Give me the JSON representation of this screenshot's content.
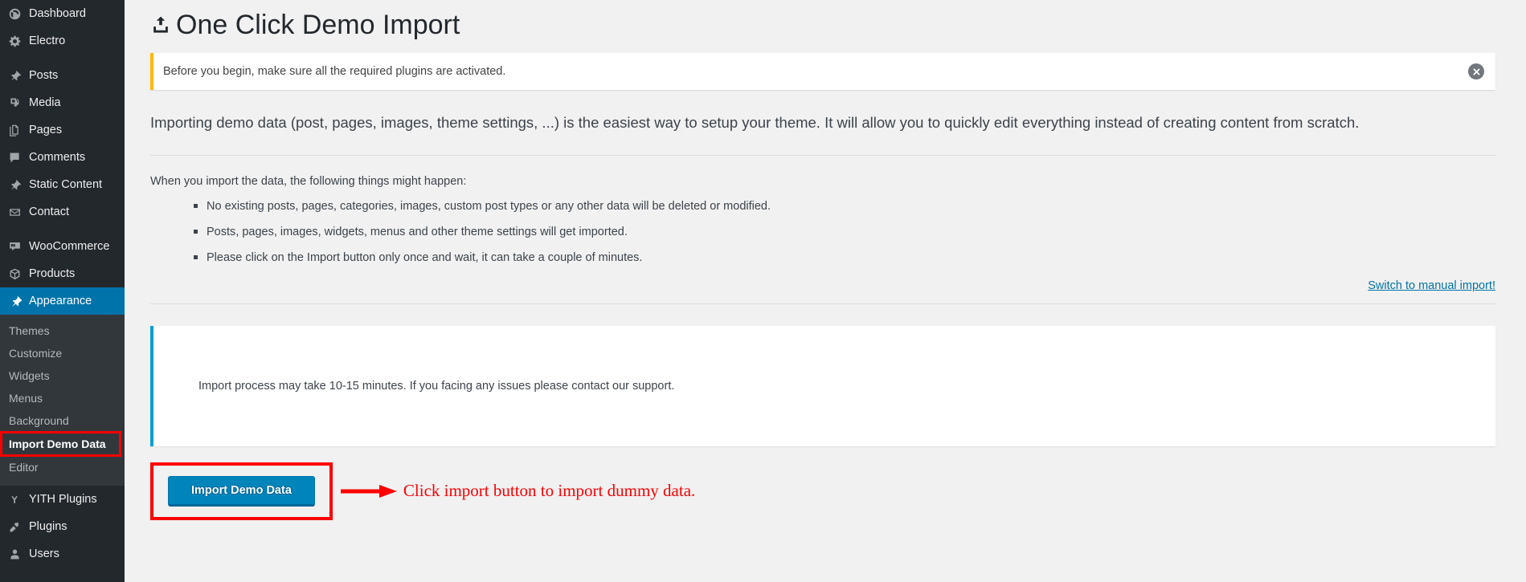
{
  "sidebar": {
    "items": [
      {
        "label": "Dashboard",
        "icon": "dashboard-icon",
        "current": false,
        "separator_after": false
      },
      {
        "label": "Electro",
        "icon": "gear-icon",
        "current": false,
        "separator_after": true
      },
      {
        "label": "Posts",
        "icon": "pin-icon",
        "current": false,
        "separator_after": false
      },
      {
        "label": "Media",
        "icon": "media-icon",
        "current": false,
        "separator_after": false
      },
      {
        "label": "Pages",
        "icon": "pages-icon",
        "current": false,
        "separator_after": false
      },
      {
        "label": "Comments",
        "icon": "comment-icon",
        "current": false,
        "separator_after": false
      },
      {
        "label": "Static Content",
        "icon": "pin-icon",
        "current": false,
        "separator_after": false
      },
      {
        "label": "Contact",
        "icon": "envelope-icon",
        "current": false,
        "separator_after": true
      },
      {
        "label": "WooCommerce",
        "icon": "woo-icon",
        "current": false,
        "separator_after": false
      },
      {
        "label": "Products",
        "icon": "box-icon",
        "current": false,
        "separator_after": false
      },
      {
        "label": "Appearance",
        "icon": "paintbrush-icon",
        "current": true,
        "separator_after": false
      }
    ],
    "submenu": [
      {
        "label": "Themes",
        "active": false,
        "highlighted": false
      },
      {
        "label": "Customize",
        "active": false,
        "highlighted": false
      },
      {
        "label": "Widgets",
        "active": false,
        "highlighted": false
      },
      {
        "label": "Menus",
        "active": false,
        "highlighted": false
      },
      {
        "label": "Background",
        "active": false,
        "highlighted": false
      },
      {
        "label": "Import Demo Data",
        "active": true,
        "highlighted": true
      },
      {
        "label": "Editor",
        "active": false,
        "highlighted": false
      }
    ],
    "items_after": [
      {
        "label": "YITH Plugins",
        "icon": "yith-icon",
        "current": false,
        "separator_after": false
      },
      {
        "label": "Plugins",
        "icon": "plug-icon",
        "current": false,
        "separator_after": false
      },
      {
        "label": "Users",
        "icon": "user-icon",
        "current": false,
        "separator_after": false
      }
    ],
    "accent_color": "#0073aa",
    "background_color": "#23282d",
    "submenu_background_color": "#32373c",
    "highlight_outline_color": "#fe0000"
  },
  "page": {
    "title": "One Click Demo Import",
    "title_icon": "upload-icon"
  },
  "notice": {
    "text": "Before you begin, make sure all the required plugins are activated.",
    "dismiss_icon": "close-circle-icon",
    "accent_color": "#ffb900"
  },
  "content": {
    "intro": "Importing demo data (post, pages, images, theme settings, ...) is the easiest way to setup your theme. It will allow you to quickly edit everything instead of creating content from scratch.",
    "lead": "When you import the data, the following things might happen:",
    "bullets": [
      "No existing posts, pages, categories, images, custom post types or any other data will be deleted or modified.",
      "Posts, pages, images, widgets, menus and other theme settings will get imported.",
      "Please click on the Import button only once and wait, it can take a couple of minutes."
    ],
    "manual_link": "Switch to manual import!",
    "manual_link_color": "#0073aa",
    "info_card_text": "Import process may take 10-15 minutes. If you facing any issues please contact our support.",
    "info_card_accent_color": "#00a0d2"
  },
  "actions": {
    "import_button_label": "Import Demo Data",
    "import_button_color": "#0085ba"
  },
  "annotation": {
    "text": "Click import button to import dummy data.",
    "color": "#fe0000",
    "arrow_icon": "arrow-right-icon"
  }
}
